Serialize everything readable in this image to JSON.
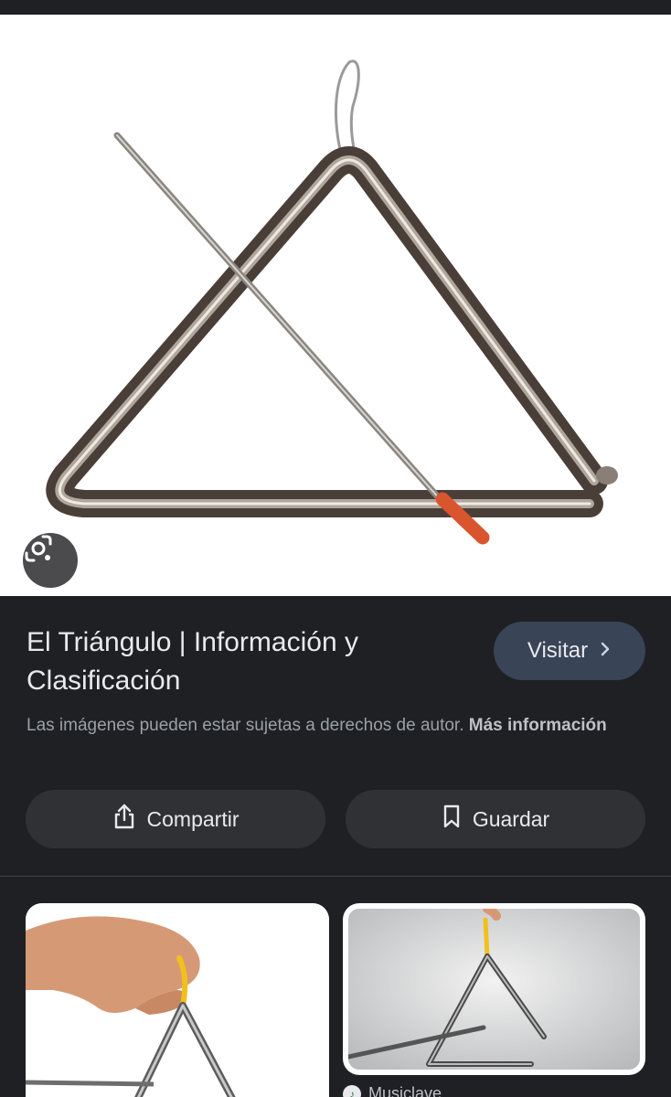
{
  "result": {
    "title": "El Triángulo | Información y Clasificación",
    "visit_label": "Visitar",
    "copyright_text": "Las imágenes pueden estar sujetas a derechos de autor.",
    "more_info_label": "Más información",
    "share_label": "Compartir",
    "save_label": "Guardar"
  },
  "related": {
    "second_source": "Musiclave"
  },
  "icons": {
    "lens": "lens-icon",
    "visit": "chevron-right-icon",
    "share": "share-icon",
    "save": "bookmark-icon"
  },
  "colors": {
    "background": "#1f2023",
    "visit_button": "#394457",
    "action_button": "#303134",
    "muted_text": "#9aa0a6"
  }
}
